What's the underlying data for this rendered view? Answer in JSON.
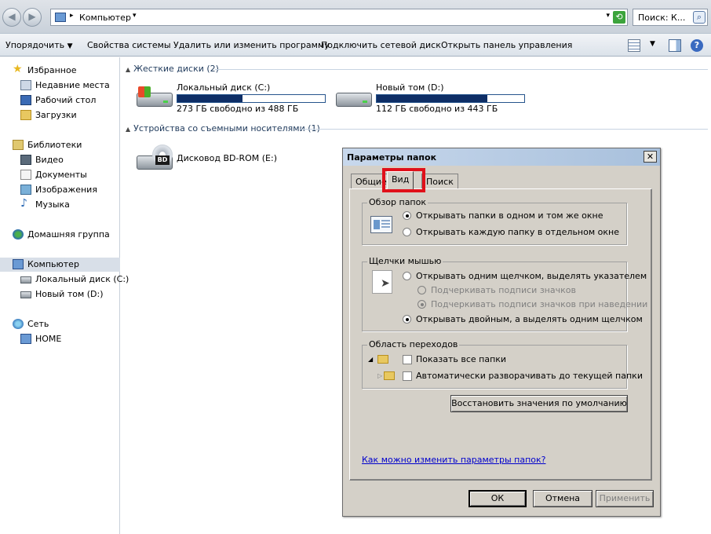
{
  "address_bar": {
    "back_icon": "back-arrow-icon",
    "forward_icon": "forward-arrow-icon",
    "breadcrumb": "Компьютер",
    "search_placeholder": "Поиск: К..."
  },
  "toolbar": {
    "organize": "Упорядочить",
    "system_properties": "Свойства системы",
    "uninstall": "Удалить или изменить программу",
    "map_drive": "Подключить сетевой диск",
    "control_panel": "Открыть панель управления"
  },
  "nav": {
    "favorites": "Избранное",
    "recent": "Недавние места",
    "desktop": "Рабочий стол",
    "downloads": "Загрузки",
    "libraries": "Библиотеки",
    "video": "Видео",
    "documents": "Документы",
    "images": "Изображения",
    "music": "Музыка",
    "homegroup": "Домашняя группа",
    "computer": "Компьютер",
    "local_disk": "Локальный диск (C:)",
    "new_volume": "Новый том (D:)",
    "network": "Сеть",
    "home": "HOME"
  },
  "content": {
    "hard_disks_header": "Жесткие диски (2)",
    "removable_header": "Устройства со съемными носителями (1)",
    "drives": [
      {
        "name": "Локальный диск (C:)",
        "free": "273 ГБ свободно из 488 ГБ",
        "used_fraction": 0.44
      },
      {
        "name": "Новый том (D:)",
        "free": "112 ГБ свободно из 443 ГБ",
        "used_fraction": 0.75
      }
    ],
    "bd_rom": "Дисковод BD-ROM (E:)",
    "bd_badge": "BD"
  },
  "dialog": {
    "title": "Параметры папок",
    "close": "✕",
    "tabs": [
      "Общие",
      "Вид",
      "Поиск"
    ],
    "browse_group": "Обзор папок",
    "browse_same": "Открывать папки в одном и том же окне",
    "browse_new": "Открывать каждую папку в отдельном окне",
    "click_group": "Щелчки мышью",
    "single_click": "Открывать одним щелчком, выделять указателем",
    "underline_always": "Подчеркивать подписи значков",
    "underline_hover": "Подчеркивать подписи значков при наведении",
    "double_click": "Открывать двойным, а выделять одним щелчком",
    "nav_group": "Область переходов",
    "show_all": "Показать все папки",
    "auto_expand": "Автоматически разворачивать до текущей папки",
    "restore_defaults": "Восстановить значения по умолчанию",
    "help_link": "Как можно изменить параметры папок?",
    "ok": "ОК",
    "cancel": "Отмена",
    "apply": "Применить"
  }
}
